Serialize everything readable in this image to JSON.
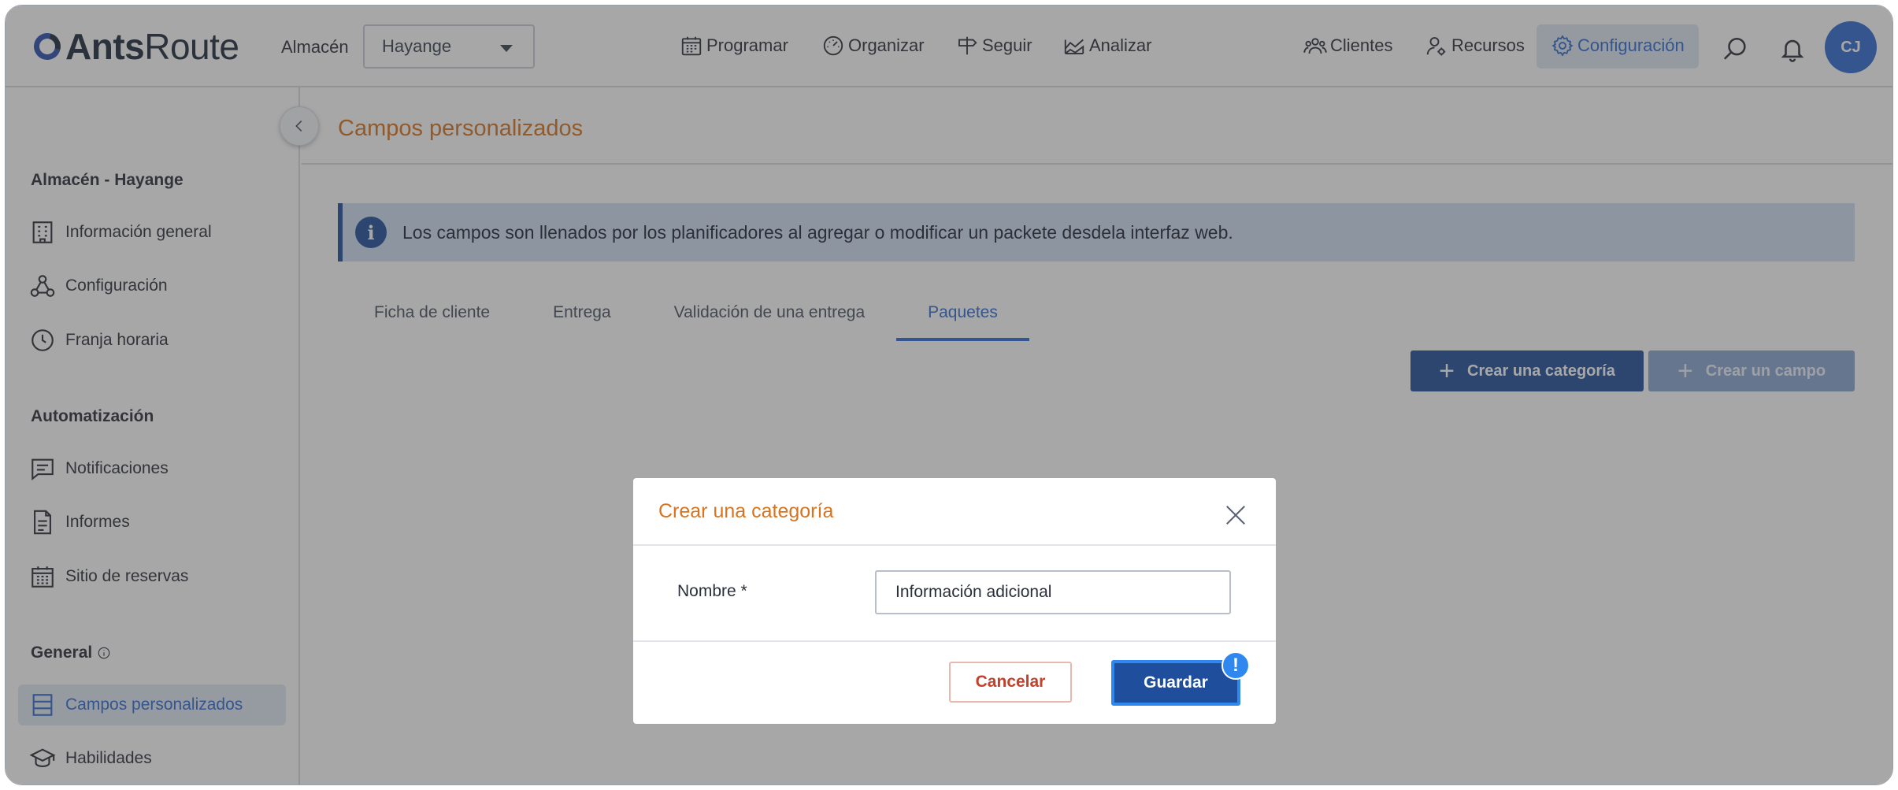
{
  "header": {
    "logo_bold": "Ants",
    "logo_light": "Route",
    "warehouse_label": "Almacén",
    "warehouse_value": "Hayange",
    "nav": {
      "schedule": "Programar",
      "organize": "Organizar",
      "track": "Seguir",
      "analyze": "Analizar",
      "clients": "Clientes",
      "resources": "Recursos",
      "settings": "Configuración"
    },
    "avatar_initials": "CJ"
  },
  "sidebar": {
    "section_warehouse": "Almacén - Hayange",
    "section_automation": "Automatización",
    "section_general": "General",
    "items": {
      "general_info": "Información general",
      "configuration": "Configuración",
      "time_slots": "Franja horaria",
      "notifications": "Notificaciones",
      "reports": "Informes",
      "booking_site": "Sitio de reservas",
      "custom_fields": "Campos personalizados",
      "skills": "Habilidades"
    }
  },
  "main": {
    "title": "Campos personalizados",
    "info_text": "Los campos son llenados por los planificadores al agregar o modificar un packete desdela interfaz web.",
    "tabs": [
      "Ficha de cliente",
      "Entrega",
      "Validación de una entrega",
      "Paquetes"
    ],
    "active_tab": "Paquetes",
    "create_category_label": "Crear una categoría",
    "create_field_label": "Crear un campo"
  },
  "modal": {
    "title": "Crear una categoría",
    "name_label": "Nombre *",
    "name_value": "Información adicional",
    "cancel_label": "Cancelar",
    "save_label": "Guardar",
    "badge": "!"
  },
  "colors": {
    "accent_orange": "#d9731d",
    "primary_blue": "#1f4f9c",
    "link_blue": "#2f6bd0"
  }
}
